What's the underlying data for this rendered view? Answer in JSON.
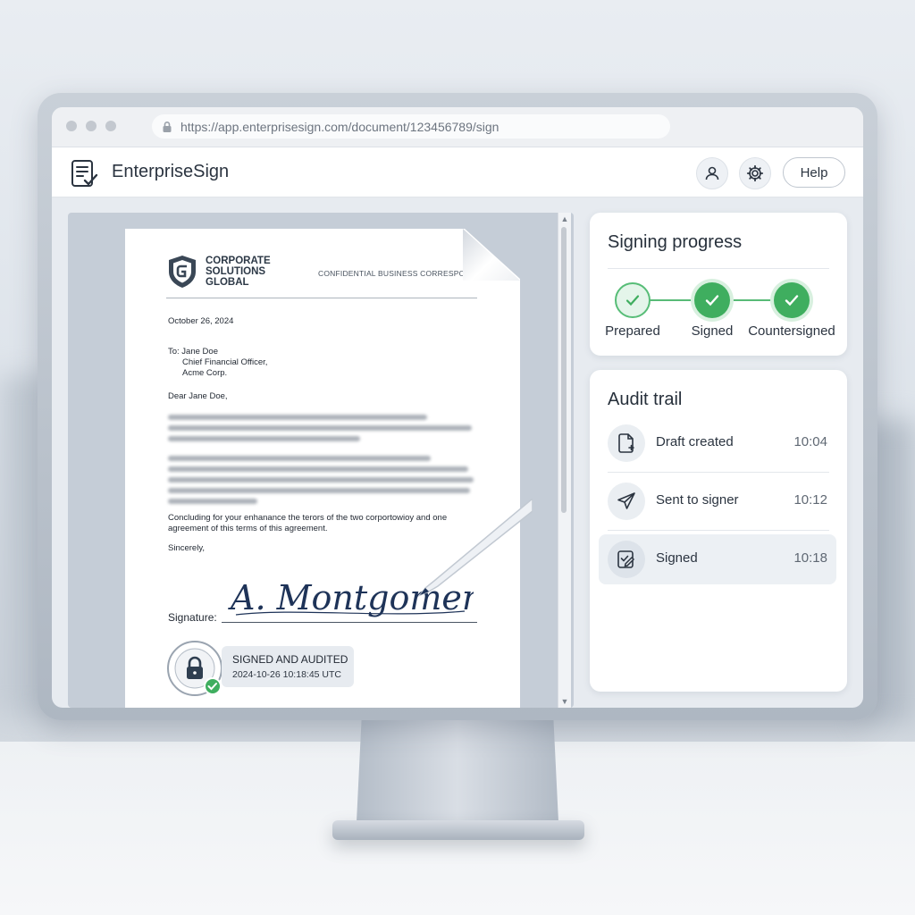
{
  "browser": {
    "url": "https://app.enterprisesign.com/document/123456789/sign"
  },
  "app": {
    "title": "EnterpriseSign",
    "help_label": "Help"
  },
  "document": {
    "company_name": "CORPORATE\nSOLUTIONS\nGLOBAL",
    "confidential_label": "CONFIDENTIAL BUSINESS CORRESPONDENC",
    "date": "October 26, 2024",
    "recipient_line1": "To: Jane Doe",
    "recipient_line2": "Chief Financial Officer,",
    "recipient_line3": "Acme Corp.",
    "salutation": "Dear Jane Doe,",
    "closing_paragraph_1": "Concluding for your enhanance the terors of the two corportowioy and one",
    "closing_paragraph_2": "agreement of this terms of this agreement.",
    "signoff": "Sincerely,",
    "signature_label": "Signature:",
    "signature_name": "A. Montgomery",
    "seal_ring_text": "SIGNED AND AUDITED",
    "stamp_title": "SIGNED AND AUDITED",
    "stamp_timestamp": "2024-10-26 10:18:45 UTC"
  },
  "signing_progress": {
    "title": "Signing progress",
    "steps": [
      {
        "label": "Prepared",
        "status": "complete-outline"
      },
      {
        "label": "Signed",
        "status": "complete"
      },
      {
        "label": "Countersigned",
        "status": "complete"
      }
    ],
    "accent_color": "#3fae5f"
  },
  "audit_trail": {
    "title": "Audit trail",
    "items": [
      {
        "label": "Draft created",
        "time": "10:04",
        "icon": "file-plus-icon"
      },
      {
        "label": "Sent to signer",
        "time": "10:12",
        "icon": "paper-plane-icon"
      },
      {
        "label": "Signed",
        "time": "10:18",
        "icon": "signed-document-icon"
      }
    ]
  }
}
